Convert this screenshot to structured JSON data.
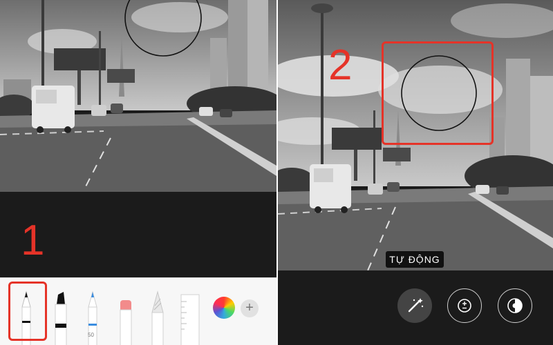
{
  "left_panel": {
    "step_number": "1",
    "tools": [
      {
        "name": "pen",
        "selected": true
      },
      {
        "name": "marker",
        "selected": false
      },
      {
        "name": "pencil",
        "selected": false,
        "label": "50"
      },
      {
        "name": "eraser",
        "selected": false
      },
      {
        "name": "fine-pencil",
        "selected": false
      },
      {
        "name": "ruler",
        "selected": false
      }
    ]
  },
  "right_panel": {
    "step_number": "2",
    "auto_label": "TỰ ĐỘNG",
    "controls": [
      "magic-wand-icon",
      "exposure-icon",
      "contrast-icon"
    ]
  },
  "colors": {
    "highlight": "#e53328",
    "pencil_blue": "#3a8de0",
    "eraser_pink": "#f28b8b"
  }
}
